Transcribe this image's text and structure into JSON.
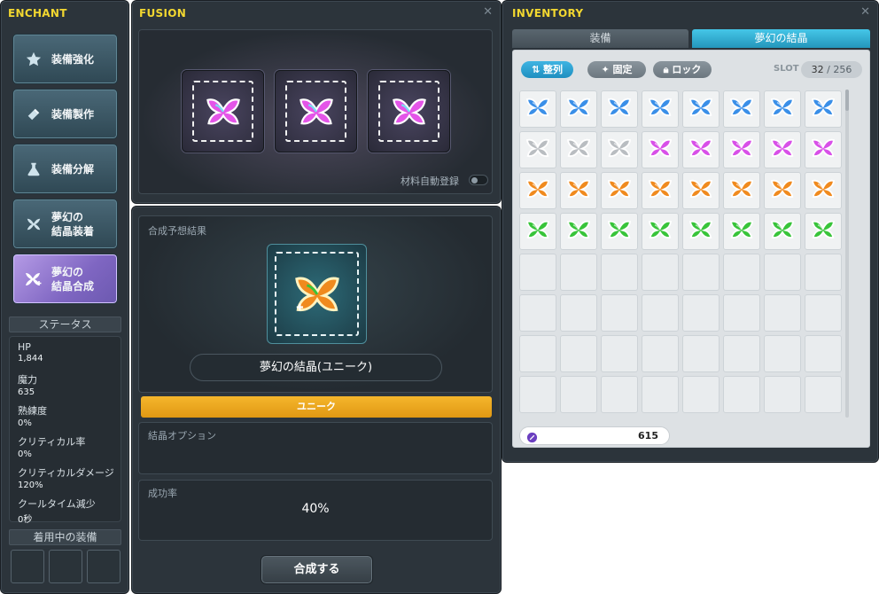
{
  "enchant": {
    "title": "ENCHANT",
    "nav": [
      {
        "label": "装備強化",
        "icon": "star-icon"
      },
      {
        "label": "装備製作",
        "icon": "hammer-icon"
      },
      {
        "label": "装備分解",
        "icon": "flask-icon"
      },
      {
        "label": "夢幻の\n結晶装着",
        "icon": "crystal-equip-icon"
      },
      {
        "label": "夢幻の\n結晶合成",
        "icon": "crystal-fusion-icon",
        "active": true
      }
    ],
    "status_header": "ステータス",
    "stats": [
      {
        "label": "HP",
        "value": "1,844"
      },
      {
        "label": "魔力",
        "value": "635"
      },
      {
        "label": "熟練度",
        "value": "0%"
      },
      {
        "label": "クリティカル率",
        "value": "0%"
      },
      {
        "label": "クリティカルダメージ",
        "value": "120%"
      },
      {
        "label": "クールタイム減少",
        "value": "0秒"
      }
    ],
    "equipped_header": "着用中の装備"
  },
  "fusion": {
    "title": "FUSION",
    "auto_register_label": "材料自動登録",
    "auto_register_on": false,
    "result_label": "合成予想結果",
    "result_item_name": "夢幻の結晶(ユニーク)",
    "rarity": "ユニーク",
    "option_label": "結晶オプション",
    "success_label": "成功率",
    "success_rate": "40%",
    "fuse_button": "合成する"
  },
  "inventory": {
    "title": "INVENTORY",
    "tabs": [
      "装備",
      "夢幻の結晶"
    ],
    "active_tab": 1,
    "sort_label": "整列",
    "fix_label": "固定",
    "lock_label": "ロック",
    "slot_label": "SLOT",
    "slot_used": "32",
    "slot_total": "256",
    "currency": "615",
    "rows": [
      [
        "blue",
        "blue",
        "blue",
        "blue",
        "blue",
        "blue",
        "blue",
        "blue"
      ],
      [
        "gray",
        "gray",
        "gray",
        "pink",
        "pink",
        "pink",
        "pink",
        "pink"
      ],
      [
        "orange",
        "orange",
        "orange",
        "orange",
        "orange",
        "orange",
        "orange",
        "orange"
      ],
      [
        "green",
        "green",
        "green",
        "green",
        "green",
        "green",
        "green",
        "green"
      ]
    ],
    "empty_rows": 4
  },
  "colors": {
    "title_yellow": "#f2d730",
    "rarity_orange": "#f0a820",
    "active_tab": "#2fb3d8",
    "crystal_blue": "#3a8fe8",
    "crystal_gray": "#b9bdc1",
    "crystal_pink": "#d850e8",
    "crystal_orange": "#f08a1e",
    "crystal_green": "#38c43a"
  }
}
